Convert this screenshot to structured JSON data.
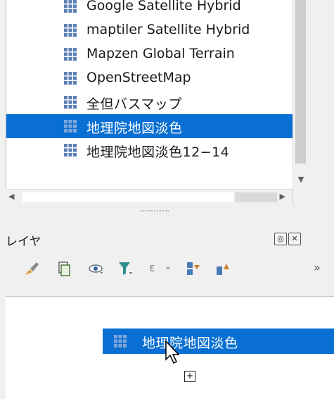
{
  "browser": {
    "items": [
      {
        "label": "Google Satellite Hybrid",
        "selected": false
      },
      {
        "label": "maptiler Satellite Hybrid",
        "selected": false
      },
      {
        "label": "Mapzen Global Terrain",
        "selected": false
      },
      {
        "label": "OpenStreetMap",
        "selected": false
      },
      {
        "label": "全但バスマップ",
        "selected": false
      },
      {
        "label": "地理院地図淡色",
        "selected": true
      },
      {
        "label": "地理院地図淡色12−14",
        "selected": false
      }
    ]
  },
  "layers": {
    "title": "レイヤ",
    "toolbar": {
      "epsilon_label": "ε",
      "more_label": "»"
    }
  },
  "drag": {
    "label": "地理院地図淡色"
  },
  "colors": {
    "selection": "#0a6fd2",
    "grid_icon": "#5b7fb3"
  },
  "icons": [
    "grid-icon",
    "paint-brush-icon",
    "add-group-icon",
    "eye-icon",
    "filter-icon",
    "expression-filter-icon",
    "expand-all-icon",
    "collapse-all-icon",
    "float-panel-icon",
    "close-panel-icon",
    "cursor-icon",
    "plus-icon"
  ]
}
